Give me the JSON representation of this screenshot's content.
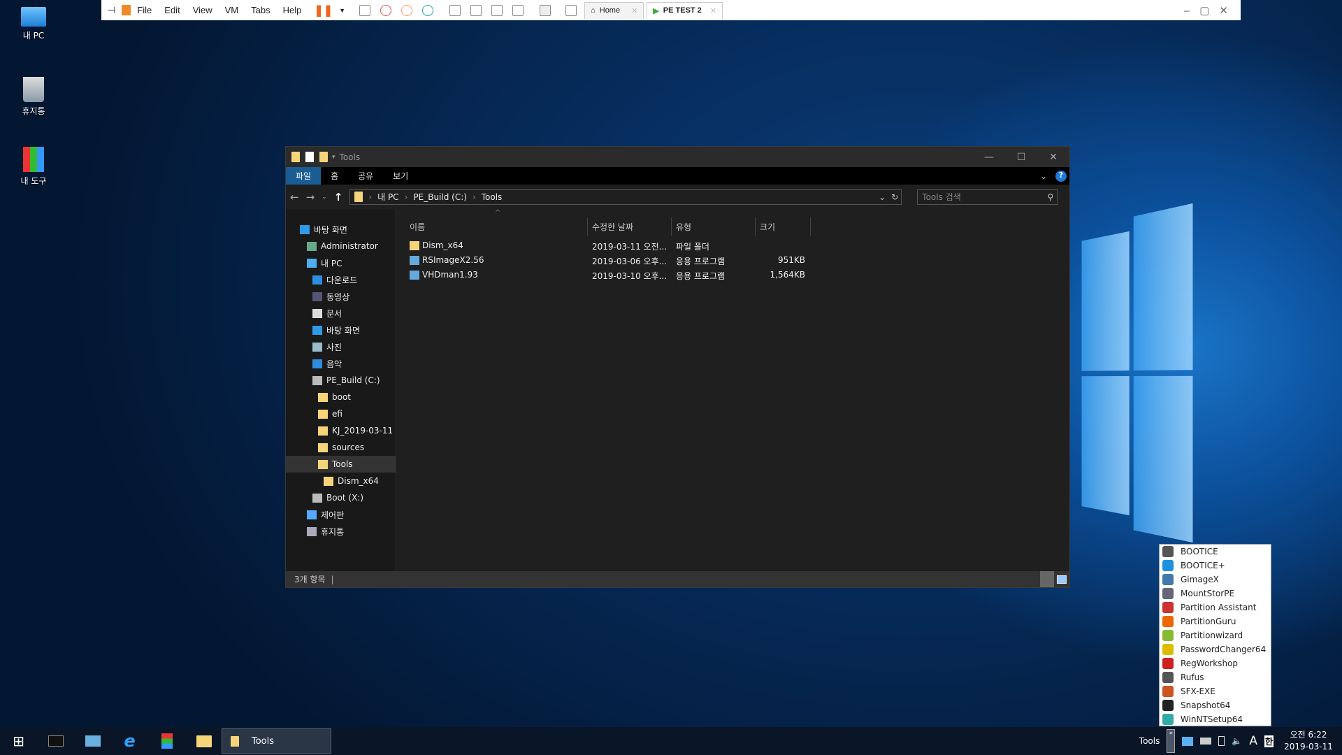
{
  "vm_toolbar": {
    "menus": [
      "File",
      "Edit",
      "View",
      "VM",
      "Tabs",
      "Help"
    ],
    "tabs": [
      {
        "label": "Home",
        "active": false
      },
      {
        "label": "PE TEST 2",
        "active": true
      }
    ]
  },
  "desktop": {
    "icons": [
      {
        "label": "내 PC",
        "icon": "computer-icon"
      },
      {
        "label": "휴지통",
        "icon": "recycle-bin-icon"
      },
      {
        "label": "내 도구",
        "icon": "tools-icon"
      }
    ]
  },
  "explorer": {
    "title": "Tools",
    "ribbon_tabs": [
      "파일",
      "홈",
      "공유",
      "보기"
    ],
    "breadcrumb": [
      "내 PC",
      "PE_Build (C:)",
      "Tools"
    ],
    "search_placeholder": "Tools 검색",
    "nav": [
      {
        "label": "바탕 화면",
        "icon": "desktop-icon",
        "level": 0
      },
      {
        "label": "Administrator",
        "icon": "user-icon",
        "level": 1
      },
      {
        "label": "내 PC",
        "icon": "computer-icon",
        "level": 1
      },
      {
        "label": "다운로드",
        "icon": "download-icon",
        "level": 2
      },
      {
        "label": "동영상",
        "icon": "video-icon",
        "level": 2
      },
      {
        "label": "문서",
        "icon": "document-icon",
        "level": 2
      },
      {
        "label": "바탕 화면",
        "icon": "desktop-icon",
        "level": 2
      },
      {
        "label": "사진",
        "icon": "picture-icon",
        "level": 2
      },
      {
        "label": "음악",
        "icon": "music-icon",
        "level": 2
      },
      {
        "label": "PE_Build (C:)",
        "icon": "drive-icon",
        "level": 2
      },
      {
        "label": "boot",
        "icon": "folder-icon",
        "level": 3
      },
      {
        "label": "efi",
        "icon": "folder-icon",
        "level": 3
      },
      {
        "label": "KJ_2019-03-11",
        "icon": "folder-icon",
        "level": 3
      },
      {
        "label": "sources",
        "icon": "folder-icon",
        "level": 3
      },
      {
        "label": "Tools",
        "icon": "folder-icon",
        "level": 3,
        "selected": true
      },
      {
        "label": "Dism_x64",
        "icon": "folder-icon",
        "level": 4
      },
      {
        "label": "Boot (X:)",
        "icon": "drive-icon",
        "level": 2
      },
      {
        "label": "제어판",
        "icon": "control-panel-icon",
        "level": 1
      },
      {
        "label": "휴지통",
        "icon": "recycle-bin-icon",
        "level": 1
      }
    ],
    "columns": [
      "이름",
      "수정한 날짜",
      "유형",
      "크기"
    ],
    "files": [
      {
        "name": "Dism_x64",
        "date": "2019-03-11 오전...",
        "type": "파일 폴더",
        "size": "",
        "icon": "folder-icon"
      },
      {
        "name": "RSImageX2.56",
        "date": "2019-03-06 오후...",
        "type": "응용 프로그램",
        "size": "951KB",
        "icon": "app-icon"
      },
      {
        "name": "VHDman1.93",
        "date": "2019-03-10 오후...",
        "type": "응용 프로그램",
        "size": "1,564KB",
        "icon": "app-icon"
      }
    ],
    "status": "3개 항목"
  },
  "tools_menu": [
    "BOOTICE",
    "BOOTICE+",
    "GimageX",
    "MountStorPE",
    "Partition Assistant",
    "PartitionGuru",
    "Partitionwizard",
    "PasswordChanger64",
    "RegWorkshop",
    "Rufus",
    "SFX-EXE",
    "Snapshot64",
    "WinNTSetup64"
  ],
  "taskbar": {
    "active_window": "Tools",
    "toolbar_label": "Tools",
    "ime_mode": "A",
    "ime_lang": "한",
    "time": "오전 6:22",
    "date": "2019-03-11"
  },
  "colors": {
    "accent": "#1a5c94",
    "folder": "#f6d57a"
  }
}
